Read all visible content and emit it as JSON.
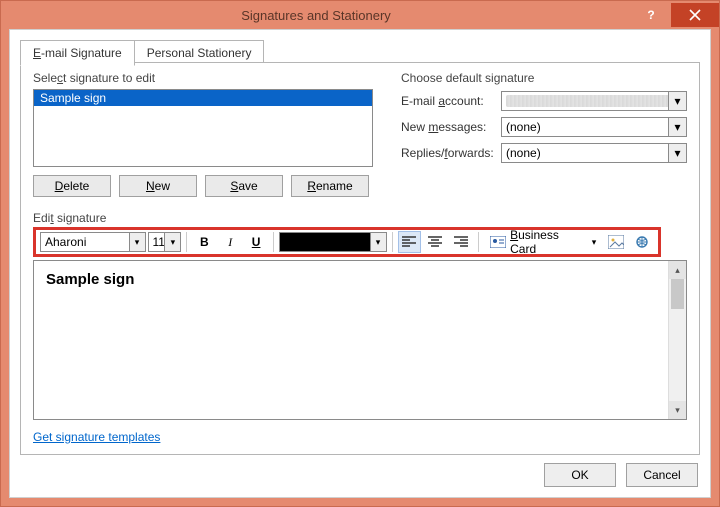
{
  "title": "Signatures and Stationery",
  "tabs": {
    "email": "E-mail Signature",
    "stationery": "Personal Stationery"
  },
  "selectLabel": "Select signature to edit",
  "signatureList": {
    "item0": "Sample sign"
  },
  "buttons": {
    "delete": "Delete",
    "new": "New",
    "save": "Save",
    "rename": "Rename"
  },
  "defaultLabel": "Choose default signature",
  "fields": {
    "emailAccount": {
      "label": "E-mail account:"
    },
    "newMessages": {
      "label": "New messages:",
      "value": "(none)"
    },
    "replies": {
      "label": "Replies/forwards:",
      "value": "(none)"
    }
  },
  "editLabel": "Edit signature",
  "toolbar": {
    "font": "Aharoni",
    "size": "11",
    "businessCard": "Business Card"
  },
  "editorContent": "Sample sign",
  "templatesLink": "Get signature templates",
  "dlg": {
    "ok": "OK",
    "cancel": "Cancel"
  }
}
